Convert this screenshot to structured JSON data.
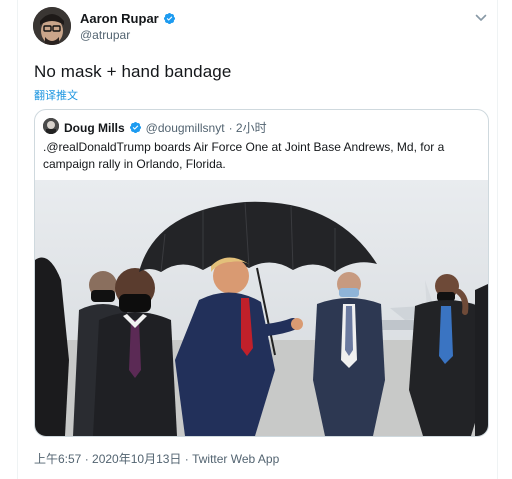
{
  "tweet": {
    "author_name": "Aaron Rupar",
    "author_handle": "@atrupar",
    "text": "No mask + hand bandage",
    "translate_label": "翻译推文",
    "timestamp": "上午6:57 · 2020年10月13日",
    "separator": " · ",
    "source": "Twitter Web App"
  },
  "quote": {
    "author_name": "Doug Mills",
    "author_handle": "@dougmillsnyt",
    "time": "· 2小时",
    "mention": ".@realDonaldTrump",
    "text_rest": "  boards Air Force One at Joint Base Andrews, Md, for a campaign rally in Orlando, Florida."
  },
  "colors": {
    "verified": "#1d9bf0",
    "link": "#1b95e0",
    "text": "#14171a",
    "secondary": "#536471",
    "border": "#cfd9de"
  },
  "icons": {
    "verified": "verified-badge-icon",
    "caret": "chevron-down-icon"
  }
}
